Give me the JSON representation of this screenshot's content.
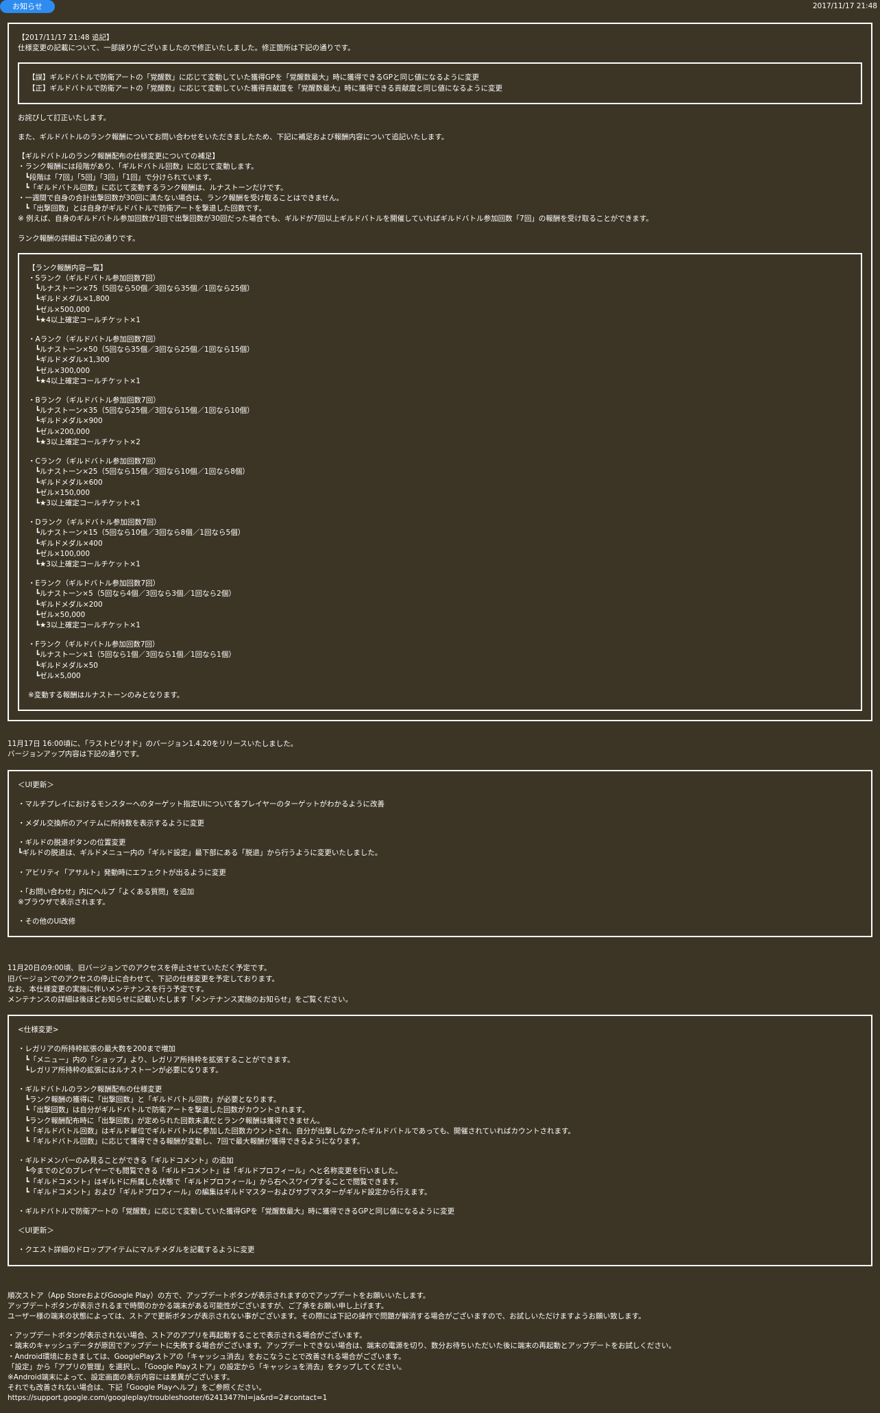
{
  "header": {
    "badge": "お知らせ",
    "date": "2017/11/17 21:48"
  },
  "sections": [
    {
      "kind": "outer-box",
      "blocks": [
        {
          "type": "para",
          "lines": [
            "【2017/11/17 21:48 追記】",
            "仕様変更の記載について、一部誤りがございましたので修正いたしました。修正箇所は下記の通りです。"
          ]
        },
        {
          "type": "box",
          "blocks": [
            {
              "type": "para",
              "lines": [
                "【誤】ギルドバトルで防衛アートの「覚醒数」に応じて変動していた獲得GPを「覚醒数最大」時に獲得できるGPと同じ値になるように変更",
                "【正】ギルドバトルで防衛アートの「覚醒数」に応じて変動していた獲得貢献度を「覚醒数最大」時に獲得できる貢献度と同じ値になるように変更"
              ]
            }
          ]
        },
        {
          "type": "para",
          "lines": [
            "お詫びして訂正いたします。"
          ]
        },
        {
          "type": "para",
          "lines": [
            "また、ギルドバトルのランク報酬についてお問い合わせをいただきましたため、下記に補足および報酬内容について追記いたします。"
          ]
        },
        {
          "type": "para",
          "lines": [
            "【ギルドバトルのランク報酬配布の仕様変更についての補足】",
            "・ランク報酬には段階があり、「ギルドバトル回数」に応じて変動します。",
            "　┗段階は「7回」「5回」「3回」「1回」で分けられています。",
            "　┗「ギルドバトル回数」に応じて変動するランク報酬は、ルナストーンだけです。",
            "・一週間で自身の合計出撃回数が30回に満たない場合は、ランク報酬を受け取ることはできません。",
            "　┗「出撃回数」とは自身がギルドバトルで防衛アートを撃退した回数です。",
            "※ 例えば、自身のギルドバトル参加回数が1回で出撃回数が30回だった場合でも、ギルドが7回以上ギルドバトルを開催していればギルドバトル参加回数「7回」の報酬を受け取ることができます。"
          ]
        },
        {
          "type": "para",
          "lines": [
            "ランク報酬の詳細は下記の通りです。"
          ]
        },
        {
          "type": "box",
          "blocks": [
            {
              "type": "para",
              "lines": [
                "【ランク報酬内容一覧】",
                "・Sランク（ギルドバトル参加回数7回）",
                "　┗ルナストーン×75（5回なら50個／3回なら35個／1回なら25個）",
                "　┗ギルドメダル×1,800",
                "　┗ゼル×500,000",
                "　┗★4以上確定コールチケット×1"
              ]
            },
            {
              "type": "para",
              "lines": [
                "・Aランク（ギルドバトル参加回数7回）",
                "　┗ルナストーン×50（5回なら35個／3回なら25個／1回なら15個）",
                "　┗ギルドメダル×1,300",
                "　┗ゼル×300,000",
                "　┗★4以上確定コールチケット×1"
              ]
            },
            {
              "type": "para",
              "lines": [
                "・Bランク（ギルドバトル参加回数7回）",
                "　┗ルナストーン×35（5回なら25個／3回なら15個／1回なら10個）",
                "　┗ギルドメダル×900",
                "　┗ゼル×200,000",
                "　┗★3以上確定コールチケット×2"
              ]
            },
            {
              "type": "para",
              "lines": [
                "・Cランク（ギルドバトル参加回数7回）",
                "　┗ルナストーン×25（5回なら15個／3回なら10個／1回なら8個）",
                "　┗ギルドメダル×600",
                "　┗ゼル×150,000",
                "　┗★3以上確定コールチケット×1"
              ]
            },
            {
              "type": "para",
              "lines": [
                "・Dランク（ギルドバトル参加回数7回）",
                "　┗ルナストーン×15（5回なら10個／3回なら8個／1回なら5個）",
                "　┗ギルドメダル×400",
                "　┗ゼル×100,000",
                "　┗★3以上確定コールチケット×1"
              ]
            },
            {
              "type": "para",
              "lines": [
                "・Eランク（ギルドバトル参加回数7回）",
                "　┗ルナストーン×5（5回なら4個／3回なら3個／1回なら2個）",
                "　┗ギルドメダル×200",
                "　┗ゼル×50,000",
                "　┗★3以上確定コールチケット×1"
              ]
            },
            {
              "type": "para",
              "lines": [
                "・Fランク（ギルドバトル参加回数7回）",
                "　┗ルナストーン×1（5回なら1個／3回なら1個／1回なら1個）",
                "　┗ギルドメダル×50",
                "　┗ゼル×5,000"
              ]
            },
            {
              "type": "para",
              "lines": [
                "※変動する報酬はルナストーンのみとなります。"
              ]
            }
          ]
        }
      ]
    },
    {
      "kind": "plain",
      "blocks": [
        {
          "type": "para",
          "lines": [
            "11月17日 16:00頃に、「ラストピリオド」のバージョン1.4.20をリリースいたしました。",
            "バージョンアップ内容は下記の通りです。"
          ]
        }
      ]
    },
    {
      "kind": "outer-box",
      "blocks": [
        {
          "type": "para",
          "lines": [
            "＜UI更新＞"
          ]
        },
        {
          "type": "para",
          "lines": [
            "・マルチプレイにおけるモンスターへのターゲット指定UIについて各プレイヤーのターゲットがわかるように改善"
          ]
        },
        {
          "type": "para",
          "lines": [
            "・メダル交換所のアイテムに所持数を表示するように変更"
          ]
        },
        {
          "type": "para",
          "lines": [
            "・ギルドの脱退ボタンの位置変更",
            "┗ギルドの脱退は、ギルドメニュー内の「ギルド設定」最下部にある「脱退」から行うように変更いたしました。"
          ]
        },
        {
          "type": "para",
          "lines": [
            "・アビリティ「アサルト」発動時にエフェクトが出るように変更"
          ]
        },
        {
          "type": "para",
          "lines": [
            "・「お問い合わせ」内にヘルプ「よくある質問」を追加",
            "※ブラウザで表示されます。"
          ]
        },
        {
          "type": "para",
          "lines": [
            "・その他のUI改修"
          ]
        }
      ]
    },
    {
      "kind": "plain",
      "blocks": [
        {
          "type": "para",
          "lines": [
            "11月20日の9:00頃、旧バージョンでのアクセスを停止させていただく予定です。",
            "旧バージョンでのアクセスの停止に合わせて、下記の仕様変更を予定しております。",
            "なお、本仕様変更の実施に伴いメンテナンスを行う予定です。",
            "メンテナンスの詳細は後ほどお知らせに記載いたします「メンテナンス実施のお知らせ」をご覧ください。"
          ]
        }
      ]
    },
    {
      "kind": "outer-box",
      "blocks": [
        {
          "type": "para",
          "lines": [
            "<仕様変更>"
          ]
        },
        {
          "type": "para",
          "lines": [
            "・レガリアの所持枠拡張の最大数を200まで増加",
            "　┗「メニュー」内の「ショップ」より、レガリア所持枠を拡張することができます。",
            "　┗レガリア所持枠の拡張にはルナストーンが必要になります。"
          ]
        },
        {
          "type": "para",
          "lines": [
            "・ギルドバトルのランク報酬配布の仕様変更",
            "　┗ランク報酬の獲得に「出撃回数」と「ギルドバトル回数」が必要となります。",
            "　┗「出撃回数」は自分がギルドバトルで防衛アートを撃退した回数がカウントされます。",
            "　┗ランク報酬配布時に「出撃回数」が定められた回数未満だとランク報酬は獲得できません。",
            "　┗「ギルドバトル回数」はギルド単位でギルドバトルに参加した回数カウントされ、自分が出撃しなかったギルドバトルであっても、開催されていればカウントされます。",
            "　┗「ギルドバトル回数」に応じて獲得できる報酬が変動し、7回で最大報酬が獲得できるようになります。"
          ]
        },
        {
          "type": "para",
          "lines": [
            "・ギルドメンバーのみ見ることができる「ギルドコメント」の追加",
            "　┗今までのどのプレイヤーでも閲覧できる「ギルドコメント」は「ギルドプロフィール」へと名称変更を行いました。",
            "　┗「ギルドコメント」はギルドに所属した状態で「ギルドプロフィール」から右へスワイプすることで閲覧できます。",
            "　┗「ギルドコメント」および「ギルドプロフィール」の編集はギルドマスターおよびサブマスターがギルド設定から行えます。"
          ]
        },
        {
          "type": "para",
          "lines": [
            "・ギルドバトルで防衛アートの「覚醒数」に応じて変動していた獲得GPを「覚醒数最大」時に獲得できるGPと同じ値になるように変更"
          ]
        },
        {
          "type": "para",
          "lines": [
            "＜UI更新＞"
          ]
        },
        {
          "type": "para",
          "lines": [
            "・クエスト詳細のドロップアイテムにマルチメダルを記載するように変更"
          ]
        }
      ]
    },
    {
      "kind": "plain",
      "blocks": [
        {
          "type": "para",
          "lines": [
            "順次ストア（App StoreおよびGoogle Play）の方で、アップデートボタンが表示されますのでアップデートをお願いいたします。",
            "アップデートボタンが表示されるまで時間のかかる端末がある可能性がございますが、ご了承をお願い申し上げます。",
            "ユーザー様の端末の状態によっては、ストアで更新ボタンが表示されない事がございます。その際には下記の操作で問題が解消する場合がございますので、お試しいただけますようお願い致します。"
          ]
        },
        {
          "type": "para",
          "lines": [
            "・アップデートボタンが表示されない場合、ストアのアプリを再起動することで表示される場合がございます。",
            "・端末のキャッシュデータが原因でアップデートに失敗する場合がございます。アップデートできない場合は、端末の電源を切り、数分お待ちいただいた後に端末の再起動とアップデートをお試しください。",
            "・Android環境におきましては、GooglePlayストアの「キャッシュ消去」をおこなうことで改善される場合がございます。",
            "「設定」から「アプリの管理」を選択し、「Google Playストア」の設定から「キャッシュを消去」をタップしてください。",
            "※Android端末によって、設定画面の表示内容には差異がございます。",
            "それでも改善されない場合は、下記「Google Playヘルプ」をご参照ください。",
            "https://support.google.com/googleplay/troubleshooter/6241347?hl=ja&rd=2#contact=1"
          ]
        }
      ]
    }
  ]
}
